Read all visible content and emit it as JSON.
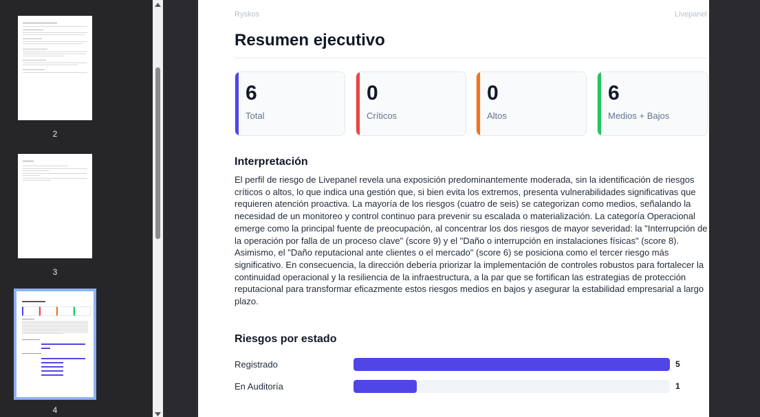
{
  "thumbnails": [
    {
      "number": "2"
    },
    {
      "number": "3"
    },
    {
      "number": "4",
      "selected": true
    }
  ],
  "page": {
    "header_left": "Ryskos",
    "header_right": "Livepanel",
    "title": "Resumen ejecutivo",
    "cards": [
      {
        "value": "6",
        "label": "Total",
        "color": "#4f46e5"
      },
      {
        "value": "0",
        "label": "Críticos",
        "color": "#ef4444"
      },
      {
        "value": "0",
        "label": "Altos",
        "color": "#f97316"
      },
      {
        "value": "6",
        "label": "Medios + Bajos",
        "color": "#22c55e"
      }
    ],
    "interpretation_heading": "Interpretación",
    "interpretation_text": "El perfil de riesgo de Livepanel revela una exposición predominantemente moderada, sin la identificación de riesgos críticos o altos, lo que indica una gestión que, si bien evita los extremos, presenta vulnerabilidades significativas que requieren atención proactiva. La mayoría de los riesgos (cuatro de seis) se categorizan como medios, señalando la necesidad de un monitoreo y control continuo para prevenir su escalada o materialización. La categoría Operacional emerge como la principal fuente de preocupación, al concentrar los dos riesgos de mayor severidad: la \"Interrupción de la operación por falla de un proceso clave\" (score 9) y el \"Daño o interrupción en instalaciones físicas\" (score 8). Asimismo, el \"Daño reputacional ante clientes o el mercado\" (score 6) se posiciona como el tercer riesgo más significativo. En consecuencia, la dirección debería priorizar la implementación de controles robustos para fortalecer la continuidad operacional y la resiliencia de la infraestructura, a la par que se fortifican las estrategias de protección reputacional para transformar eficazmente estos riesgos medios en bajos y asegurar la estabilidad empresarial a largo plazo.",
    "status_heading": "Riesgos por estado",
    "bar_color": "#4f46e5"
  },
  "chart_data": {
    "type": "bar",
    "orientation": "horizontal",
    "title": "Riesgos por estado",
    "categories": [
      "Registrado",
      "En Auditoría"
    ],
    "values": [
      5,
      1
    ],
    "xlim": [
      0,
      5
    ]
  }
}
